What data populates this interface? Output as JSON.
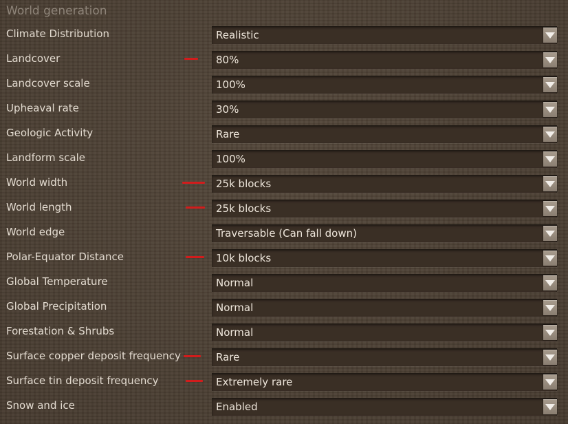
{
  "panel": {
    "title": "World generation"
  },
  "settings": [
    {
      "label": "Climate Distribution",
      "value": "Realistic",
      "marked": false
    },
    {
      "label": "Landcover",
      "value": "80%",
      "marked": true
    },
    {
      "label": "Landcover scale",
      "value": "100%",
      "marked": false
    },
    {
      "label": "Upheaval rate",
      "value": "30%",
      "marked": false
    },
    {
      "label": "Geologic Activity",
      "value": "Rare",
      "marked": false
    },
    {
      "label": "Landform scale",
      "value": "100%",
      "marked": false
    },
    {
      "label": "World width",
      "value": "25k blocks",
      "marked": true
    },
    {
      "label": "World length",
      "value": "25k blocks",
      "marked": true
    },
    {
      "label": "World edge",
      "value": "Traversable (Can fall down)",
      "marked": false
    },
    {
      "label": "Polar-Equator Distance",
      "value": "10k blocks",
      "marked": true
    },
    {
      "label": "Global Temperature",
      "value": "Normal",
      "marked": false
    },
    {
      "label": "Global Precipitation",
      "value": "Normal",
      "marked": false
    },
    {
      "label": "Forestation & Shrubs",
      "value": "Normal",
      "marked": false
    },
    {
      "label": "Surface copper deposit frequency",
      "value": "Rare",
      "marked": true
    },
    {
      "label": "Surface tin deposit frequency",
      "value": "Extremely rare",
      "marked": true
    },
    {
      "label": "Snow and ice",
      "value": "Enabled",
      "marked": false
    }
  ],
  "colors": {
    "marker": "#d21c1c",
    "label_text": "#e3dbd0",
    "value_text": "#efe7dc",
    "title_text": "#8e8479",
    "dropdown_bg": "#3a2f25",
    "arrow_bg": "#9a8e80"
  },
  "icons": {
    "dropdown_arrow": "chevron-down-icon"
  }
}
